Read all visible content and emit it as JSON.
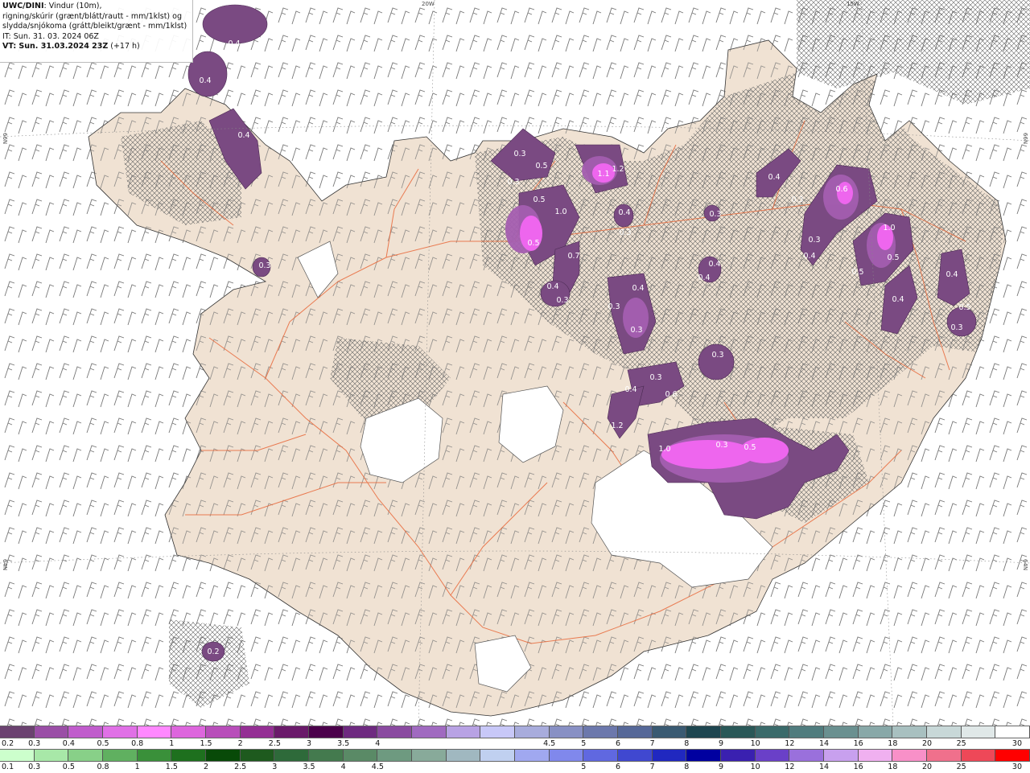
{
  "header": {
    "model": "UWC/DINI",
    "line1_rest": ": Vindur (10m),",
    "line2": "rigning/skúrir (grænt/blátt/rautt - mm/1klst) og",
    "line3": "slydda/snjókoma (grátt/bleikt/grænt - mm/1klst)",
    "issue_time": "IT: Sun. 31. 03. 2024 06Z",
    "valid_time_label": "VT: Sun. 31.03.2024 23Z",
    "lead_time": "(+17 h)"
  },
  "grid_labels": {
    "lon_20w": "20W",
    "lon_15w": "15W",
    "lat_66n_left": "66N",
    "lat_66n_right": "66N",
    "lat_64n_left": "64N",
    "lat_64n_right": "64N"
  },
  "colors": {
    "land": "#f0e2d3",
    "sea": "#ffffff",
    "roads": "#e8683a",
    "glacier": "#ffffff",
    "precip_light": "#7a4a82",
    "precip_heavy": "#ee66ee"
  },
  "precip_labels": [
    {
      "id": "v1",
      "text": "0.4"
    },
    {
      "id": "v2",
      "text": "0.4"
    },
    {
      "id": "v3",
      "text": "0.4"
    },
    {
      "id": "v4",
      "text": "0.3"
    },
    {
      "id": "v5",
      "text": "0.3"
    },
    {
      "id": "v6",
      "text": "0.5"
    },
    {
      "id": "v7",
      "text": "0.3"
    },
    {
      "id": "v8",
      "text": "1.1"
    },
    {
      "id": "v9",
      "text": "1.2"
    },
    {
      "id": "v10",
      "text": "0.5"
    },
    {
      "id": "v11",
      "text": "1.0"
    },
    {
      "id": "v12",
      "text": "0.5"
    },
    {
      "id": "v13",
      "text": "0.7"
    },
    {
      "id": "v14",
      "text": "0.4"
    },
    {
      "id": "v15",
      "text": "0.3"
    },
    {
      "id": "v16",
      "text": "0.4"
    },
    {
      "id": "v17",
      "text": "0.3"
    },
    {
      "id": "v18",
      "text": "0.3"
    },
    {
      "id": "v19",
      "text": "0.4"
    },
    {
      "id": "v20",
      "text": "0.3"
    },
    {
      "id": "v21",
      "text": "0.4"
    },
    {
      "id": "v22",
      "text": "0.4"
    },
    {
      "id": "v23",
      "text": "0.4"
    },
    {
      "id": "v24",
      "text": "0.6"
    },
    {
      "id": "v25",
      "text": "0.3"
    },
    {
      "id": "v26",
      "text": "0.3"
    },
    {
      "id": "v27",
      "text": "1.0"
    },
    {
      "id": "v28",
      "text": "0.4"
    },
    {
      "id": "v29",
      "text": "0.3"
    },
    {
      "id": "v30",
      "text": "0.5"
    },
    {
      "id": "v31",
      "text": "0.5"
    },
    {
      "id": "v32",
      "text": "0.4"
    },
    {
      "id": "v33",
      "text": "0.4"
    },
    {
      "id": "v34",
      "text": "0.5"
    },
    {
      "id": "v35",
      "text": "0.3"
    },
    {
      "id": "v36",
      "text": "0.3"
    },
    {
      "id": "v37",
      "text": "0.3"
    },
    {
      "id": "v38",
      "text": "0.4"
    },
    {
      "id": "v39",
      "text": "0.6"
    },
    {
      "id": "v40",
      "text": "1.2"
    },
    {
      "id": "v41",
      "text": "1.0"
    },
    {
      "id": "v42",
      "text": "0.3"
    },
    {
      "id": "v43",
      "text": "0.5"
    },
    {
      "id": "v44",
      "text": "0.2"
    }
  ],
  "legend_precip": {
    "colors": [
      "#6b4270",
      "#9a4ea6",
      "#c05ccc",
      "#e070e6",
      "#ff88ff",
      "#dd66dd",
      "#b84eba",
      "#942f94",
      "#6a1a6a",
      "#4a004a",
      "#6e2a80",
      "#8a4aa0",
      "#a06ac0",
      "#b8a2e4",
      "#c8c8f8",
      "#a8acdc",
      "#8890c4",
      "#6c78ac",
      "#566898",
      "#3a5a72",
      "#1e4650",
      "#2a5858",
      "#3a6a6a",
      "#507c7e",
      "#6a9090",
      "#88a8a8",
      "#a8c0c0",
      "#c8d8d8",
      "#e0e8e8",
      "#ffffff"
    ],
    "labels": [
      "0.2",
      "0.3",
      "0.4",
      "0.5",
      "0.8",
      "1",
      "1.5",
      "2",
      "2.5",
      "3",
      "3.5",
      "4",
      "4.5",
      "5",
      "6",
      "7",
      "8",
      "9",
      "10",
      "12",
      "14",
      "16",
      "18",
      "20",
      "25",
      "30"
    ]
  },
  "legend_snow": {
    "colors": [
      "#ccffcc",
      "#a8e8a8",
      "#88d088",
      "#60b060",
      "#3a903a",
      "#1e701e",
      "#084a08",
      "#1e5a1e",
      "#2e6a3a",
      "#447a4e",
      "#5a8a66",
      "#6e9a80",
      "#88aa9a",
      "#a0b8c0",
      "#c0d0f0",
      "#a0a8f0",
      "#8088ec",
      "#6068e0",
      "#4048d0",
      "#2028c0",
      "#0000a0",
      "#3a20b0",
      "#6a40c8",
      "#9a70dc",
      "#c8a0ee",
      "#f0b0f0",
      "#f890c8",
      "#f0708c",
      "#ee4858",
      "#ff0000"
    ],
    "labels": [
      "0.1",
      "0.3",
      "0.5",
      "0.8",
      "1",
      "1.5",
      "2",
      "2.5",
      "3",
      "3.5",
      "4",
      "4.5",
      "5",
      "6",
      "7",
      "8",
      "9",
      "10",
      "12",
      "14",
      "16",
      "18",
      "20",
      "25",
      "30"
    ]
  }
}
